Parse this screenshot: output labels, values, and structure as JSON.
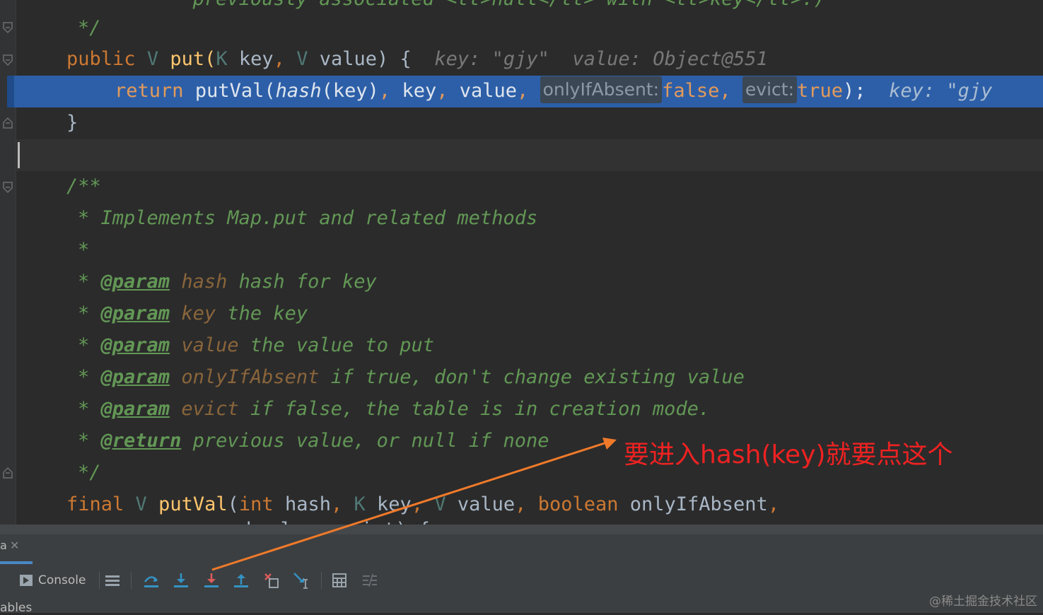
{
  "editor": {
    "lines": {
      "top_fragment": "previously associated <tt>null</tt> with <tt>key</tt>.)",
      "doc_end": "*/",
      "put_sig": {
        "kw_public": "public",
        "type_v": "V",
        "name": "put",
        "paren": "(",
        "type_k": "K",
        "param_key": "key",
        "comma": ",",
        "type_v2": "V",
        "param_value": "value",
        "close": ") {",
        "hint": "key: \"gjy\"  value: Object@551"
      },
      "return_line": {
        "kw": "return",
        "call1": "putVal(",
        "call2": "hash",
        "call3": "(key)",
        "comma1": ",",
        "arg_key": "key",
        "comma2": ",",
        "arg_value": "value",
        "comma3": ",",
        "inlay1": "onlyIfAbsent:",
        "val1": "false",
        "comma4": ",",
        "inlay2": "evict:",
        "val2": "true",
        "tail": ");",
        "hint": "key: \"gjy"
      },
      "close_brace": "}",
      "jd_open": "/**",
      "jd_1": "* Implements Map.put and related methods",
      "jd_2": "*",
      "jd_p1": {
        "star": "*",
        "tag": "@param",
        "name": "hash",
        "desc": "hash for key"
      },
      "jd_p2": {
        "star": "*",
        "tag": "@param",
        "name": "key",
        "desc": "the key"
      },
      "jd_p3": {
        "star": "*",
        "tag": "@param",
        "name": "value",
        "desc": "the value to put"
      },
      "jd_p4": {
        "star": "*",
        "tag": "@param",
        "name": "onlyIfAbsent",
        "desc": "if true, don't change existing value"
      },
      "jd_p5": {
        "star": "*",
        "tag": "@param",
        "name": "evict",
        "desc": "if false, the table is in creation mode."
      },
      "jd_ret": {
        "star": "*",
        "tag": "@return",
        "desc": "previous value, or null if none"
      },
      "jd_close": "*/",
      "putval_sig": {
        "kw_final": "final",
        "type_v": "V",
        "name": "putVal",
        "paren": "(",
        "kw_int": "int",
        "p_hash": "hash",
        "comma1": ",",
        "type_k": "K",
        "p_key": "key",
        "comma2": ",",
        "type_v2": "V",
        "p_value": "value",
        "comma3": ",",
        "kw_boolean": "boolean",
        "p_only": "onlyIfAbsent",
        "comma4": ","
      },
      "cut_line": "boolean evict) {"
    }
  },
  "annotation": {
    "text": "要进入hash(key)就要点这个",
    "color": "#ee2222",
    "arrow_color": "#f07a2a"
  },
  "debug_panel": {
    "tab_fragment": "a",
    "tab_close": "✕",
    "console_label": "Console",
    "bottom_fragment": "ables",
    "toolbar_icons": [
      "console-icon",
      "show-execution-point-icon",
      "step-over-icon",
      "step-into-icon",
      "force-step-into-icon",
      "step-out-icon",
      "drop-frame-icon",
      "run-to-cursor-icon",
      "evaluate-expression-icon",
      "trace-icon"
    ]
  },
  "watermark": "@稀土掘金技术社区",
  "colors": {
    "editor_bg": "#2b2b2b",
    "execution_line": "#2d5fa8",
    "keyword": "#cc7832",
    "method": "#ffc66d",
    "doc_comment": "#629755",
    "type_param": "#507874"
  }
}
